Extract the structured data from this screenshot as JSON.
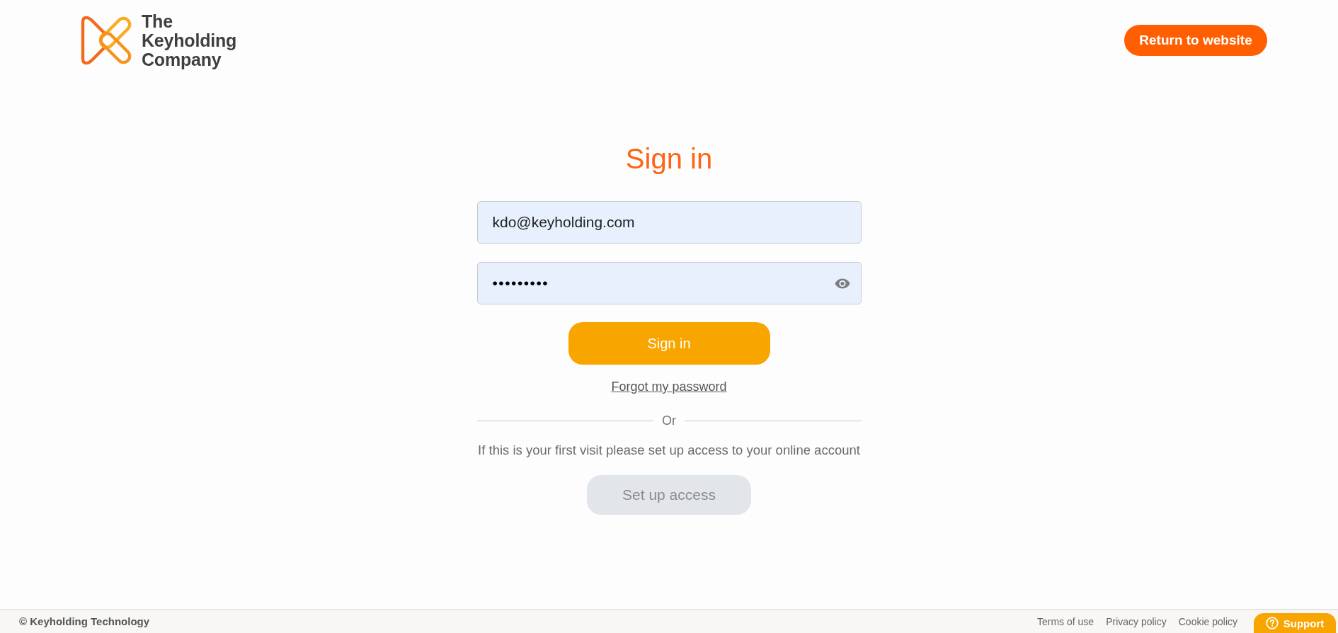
{
  "header": {
    "logo_lines": [
      "The",
      "Keyholding",
      "Company"
    ],
    "return_button": "Return to website"
  },
  "form": {
    "title": "Sign in",
    "email": {
      "value": "kdo@keyholding.com"
    },
    "password": {
      "value": "•••••••••"
    },
    "submit_button": "Sign in",
    "forgot_link": "Forgot my password",
    "divider_label": "Or",
    "first_visit_text": "If this is your first visit please set up access to your online account",
    "setup_button": "Set up access"
  },
  "footer": {
    "copyright": "© Keyholding Technology",
    "links": [
      "Terms of use",
      "Privacy policy",
      "Cookie policy"
    ],
    "support_button": "Support"
  }
}
